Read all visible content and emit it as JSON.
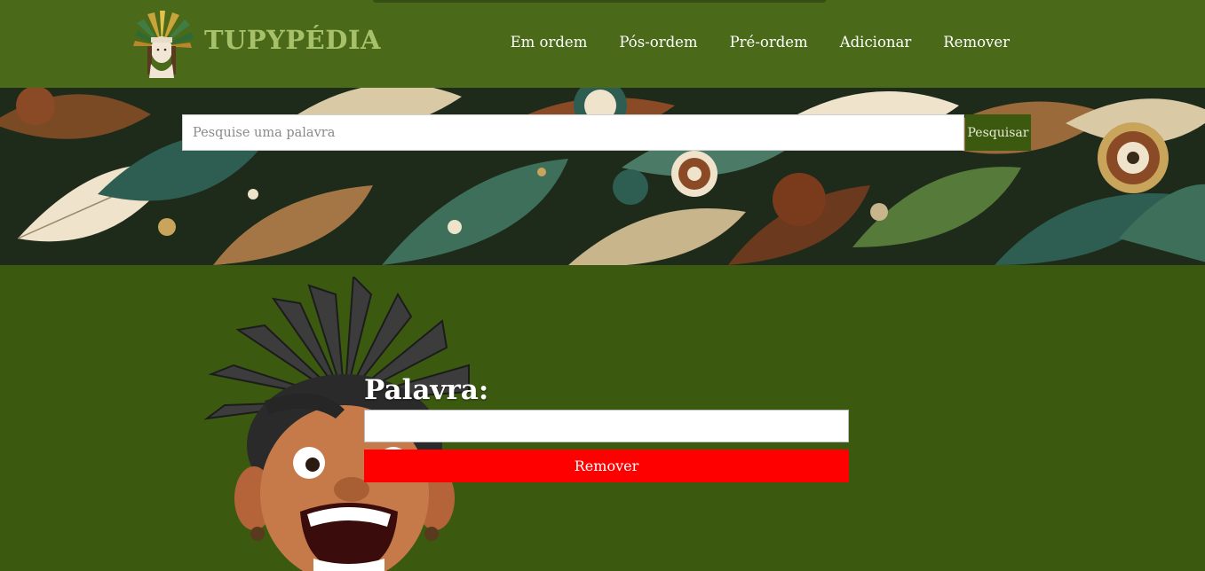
{
  "header": {
    "brand": "TUPYPÉDIA",
    "nav": [
      {
        "label": "Em ordem"
      },
      {
        "label": "Pós-ordem"
      },
      {
        "label": "Pré-ordem"
      },
      {
        "label": "Adicionar"
      },
      {
        "label": "Remover"
      }
    ]
  },
  "search": {
    "placeholder": "Pesquise uma palavra",
    "value": "",
    "button_label": "Pesquisar"
  },
  "form": {
    "label": "Palavra:",
    "input_value": "",
    "submit_label": "Remover"
  },
  "colors": {
    "header_bg": "#4a6a19",
    "page_bg": "#3b5a10",
    "brand": "#a6c16a",
    "danger": "#ff0000"
  }
}
